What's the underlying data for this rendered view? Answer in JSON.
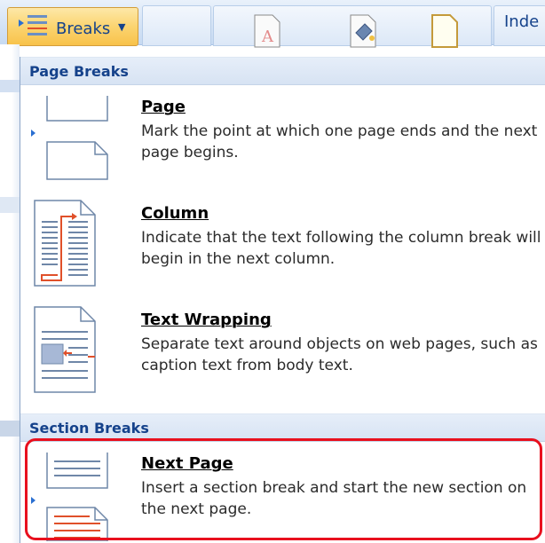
{
  "ribbon": {
    "breaks_label": "Breaks",
    "indent_label": "Inde"
  },
  "menu": {
    "sections": [
      {
        "header": "Page Breaks",
        "items": [
          {
            "title": "Page",
            "description": "Mark the point at which one page ends and the next page begins."
          },
          {
            "title": "Column",
            "description": "Indicate that the text following the column break will begin in the next column."
          },
          {
            "title": "Text Wrapping",
            "description": "Separate text around objects on web pages, such as caption text from body text."
          }
        ]
      },
      {
        "header": "Section Breaks",
        "items": [
          {
            "title": "Next Page",
            "description": "Insert a section break and start the new section on the next page."
          }
        ]
      }
    ]
  },
  "colors": {
    "accent": "#15428b",
    "highlight": "#e8101e",
    "break_marker": "#e0502a"
  }
}
